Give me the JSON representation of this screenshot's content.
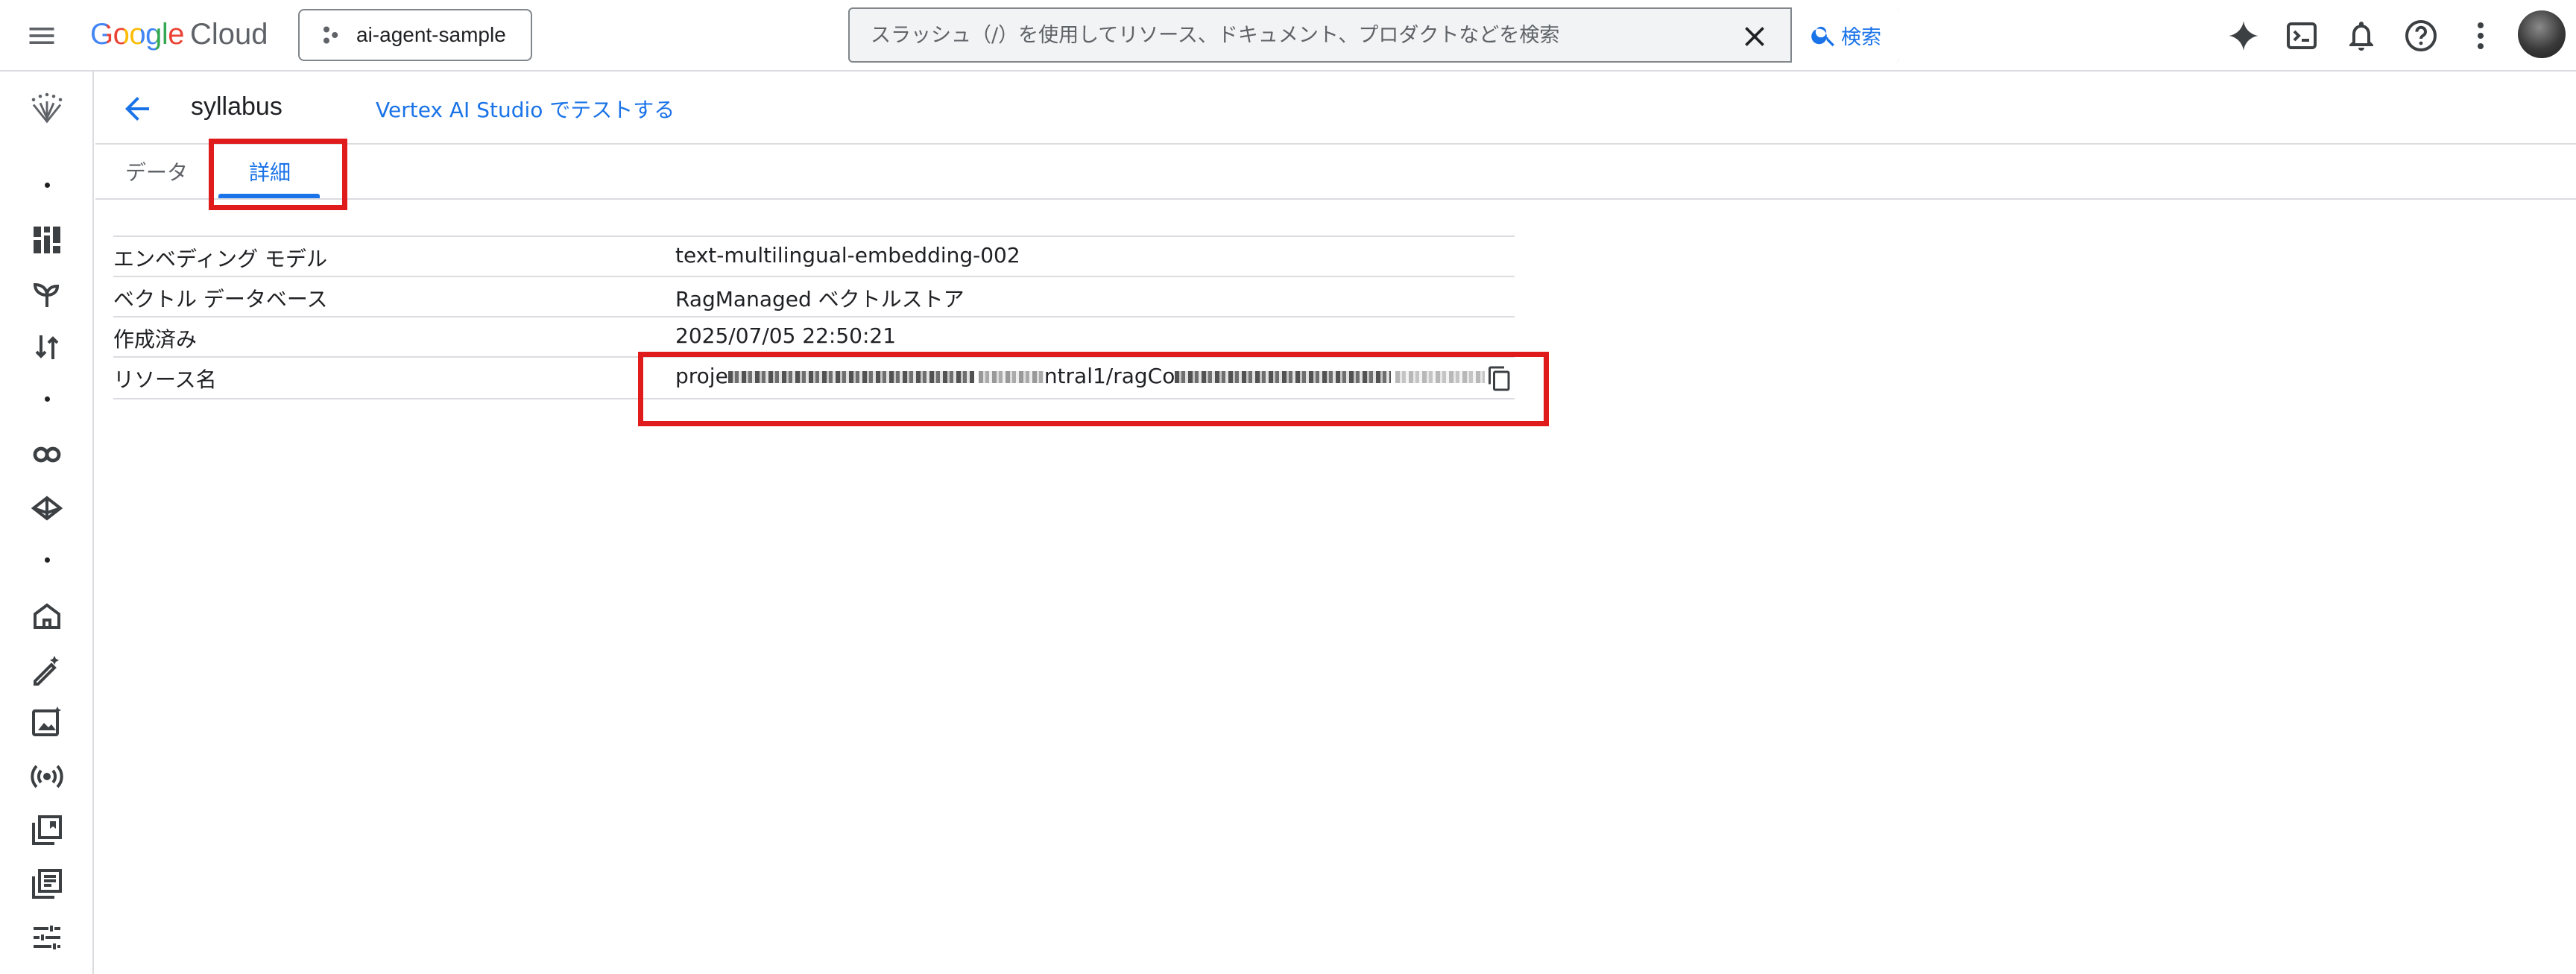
{
  "header": {
    "logo_google": "Google",
    "logo_cloud": "Cloud",
    "project": "ai-agent-sample",
    "search": {
      "placeholder": "スラッシュ（/）を使用してリソース、ドキュメント、プロダクトなどを検索",
      "button_label": "検索"
    },
    "icons": [
      "gemini-icon",
      "cloud-shell-icon",
      "notifications-icon",
      "help-icon",
      "more-vert-icon"
    ]
  },
  "rail": {
    "icons": [
      "vertex-ai-logo-icon",
      "dashboard-icon",
      "model-garden-icon",
      "pipelines-icon",
      "agent-icon",
      "build-icon",
      "home-icon",
      "prompt-icon",
      "image-icon",
      "live-api-icon",
      "rag-icon",
      "notebook-icon",
      "tuning-icon"
    ]
  },
  "page": {
    "title": "syllabus",
    "studio_link": "Vertex AI Studio でテストする",
    "tabs": [
      {
        "label": "データ",
        "active": false
      },
      {
        "label": "詳細",
        "active": true
      }
    ],
    "details": [
      {
        "label": "エンベディング モデル",
        "value": "text-multilingual-embedding-002"
      },
      {
        "label": "ベクトル データベース",
        "value": "RagManaged ベクトルストア"
      },
      {
        "label": "作成済み",
        "value": "2025/07/05 22:50:21"
      },
      {
        "label": "リソース名",
        "value_prefix": "proje",
        "value_middle": "ntral1/ragCo"
      }
    ]
  },
  "colors": {
    "accent": "#1a73e8",
    "annotation": "#e01b1b",
    "divider": "#dadce0"
  }
}
